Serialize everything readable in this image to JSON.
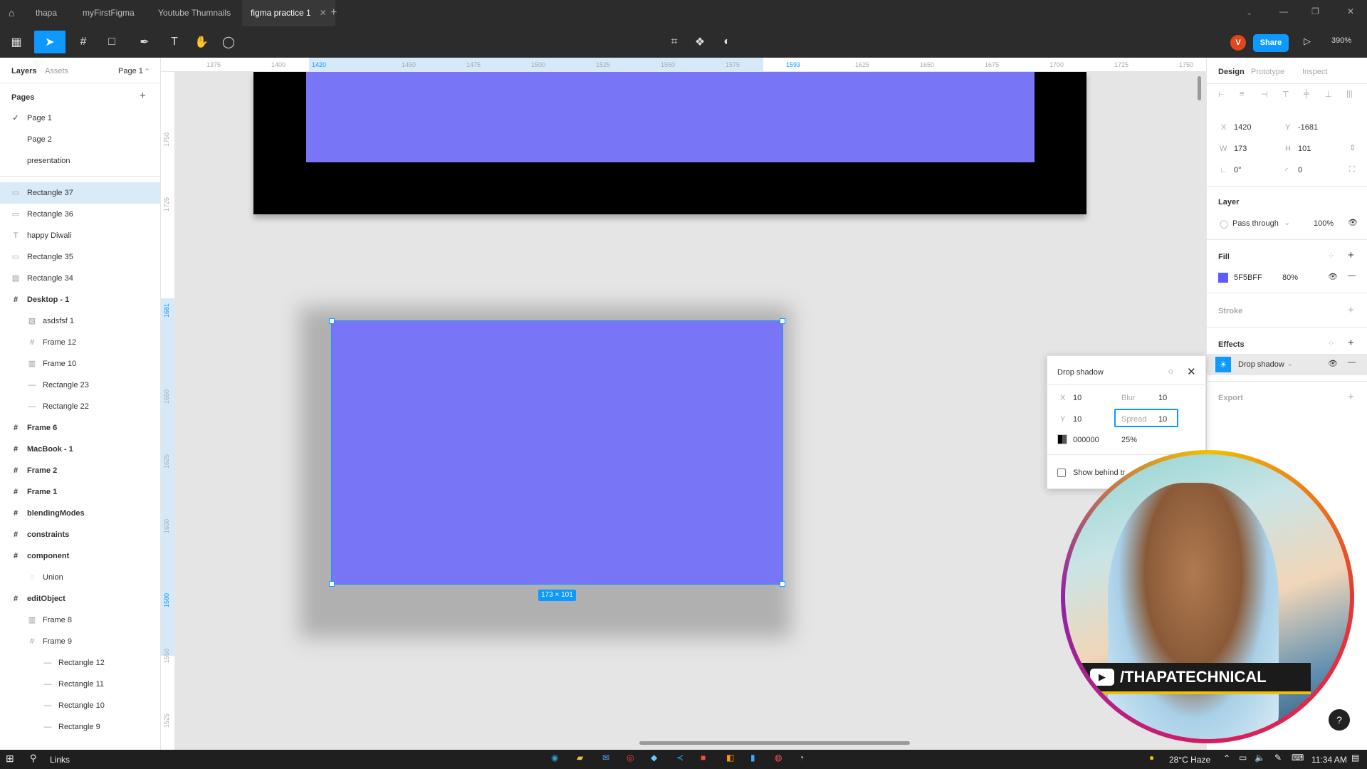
{
  "tabs": {
    "items": [
      {
        "label": "thapa"
      },
      {
        "label": "myFirstFigma"
      },
      {
        "label": "Youtube Thumnails"
      },
      {
        "label": "figma practice 1"
      }
    ],
    "add": "+"
  },
  "toolbar": {
    "avatar_letter": "V",
    "share_label": "Share",
    "zoom": "390%"
  },
  "left_panel": {
    "tab_layers": "Layers",
    "tab_assets": "Assets",
    "page_selector": "Page 1",
    "pages_title": "Pages",
    "pages": [
      {
        "label": "Page 1",
        "check": "✓"
      },
      {
        "label": "Page 2"
      },
      {
        "label": "presentation"
      }
    ],
    "layers": [
      {
        "label": "Rectangle 37"
      },
      {
        "label": "Rectangle 36"
      },
      {
        "label": "happy Diwali"
      },
      {
        "label": "Rectangle 35"
      },
      {
        "label": "Rectangle 34"
      },
      {
        "label": "Desktop - 1"
      },
      {
        "label": "asdsfsf 1"
      },
      {
        "label": "Frame 12"
      },
      {
        "label": "Frame 10"
      },
      {
        "label": "Rectangle 23"
      },
      {
        "label": "Rectangle 22"
      },
      {
        "label": "Frame 6"
      },
      {
        "label": "MacBook - 1"
      },
      {
        "label": "Frame 2"
      },
      {
        "label": "Frame 1"
      },
      {
        "label": "blendingModes"
      },
      {
        "label": "constraints"
      },
      {
        "label": "component"
      },
      {
        "label": "Union"
      },
      {
        "label": "editObject"
      },
      {
        "label": "Frame 8"
      },
      {
        "label": "Frame 9"
      },
      {
        "label": "Rectangle 12"
      },
      {
        "label": "Rectangle 11"
      },
      {
        "label": "Rectangle 10"
      },
      {
        "label": "Rectangle 9"
      }
    ]
  },
  "rulers": {
    "h": [
      "1375",
      "1400",
      "1420",
      "1450",
      "1475",
      "1500",
      "1525",
      "1550",
      "1575",
      "1593",
      "1625",
      "1650",
      "1675",
      "1700",
      "1725",
      "1750"
    ],
    "v": [
      "1750",
      "1725",
      "1681",
      "1650",
      "1625",
      "1600",
      "1580",
      "1550",
      "1525"
    ]
  },
  "canvas": {
    "size_badge": "173 × 101",
    "rect_color": "#7876F6",
    "frame_color": "#000000"
  },
  "right_panel": {
    "tabs": [
      "Design",
      "Prototype",
      "Inspect"
    ],
    "x_label": "X",
    "x": "1420",
    "y_label": "Y",
    "y": "-1681",
    "w_label": "W",
    "w": "173",
    "h_label": "H",
    "h": "101",
    "rotation": "0°",
    "radius": "0",
    "layer_title": "Layer",
    "blend": "Pass through",
    "opacity": "100%",
    "fill_title": "Fill",
    "fill_hex": "5F5BFF",
    "fill_opacity": "80%",
    "fill_color": "#5F5BFF",
    "stroke_title": "Stroke",
    "effects_title": "Effects",
    "effect_name": "Drop shadow",
    "export_title": "Export"
  },
  "popup": {
    "title": "Drop shadow",
    "x_label": "X",
    "x": "10",
    "blur_label": "Blur",
    "blur": "10",
    "y_label": "Y",
    "y": "10",
    "spread_label": "Spread",
    "spread": "10",
    "color_hex": "000000",
    "color_opacity": "25%",
    "show_behind": "Show behind tr"
  },
  "webcam": {
    "channel": "/THAPATECHNICAL"
  },
  "taskbar": {
    "search": "Links",
    "weather": "28°C Haze",
    "time": "11:34 AM"
  }
}
